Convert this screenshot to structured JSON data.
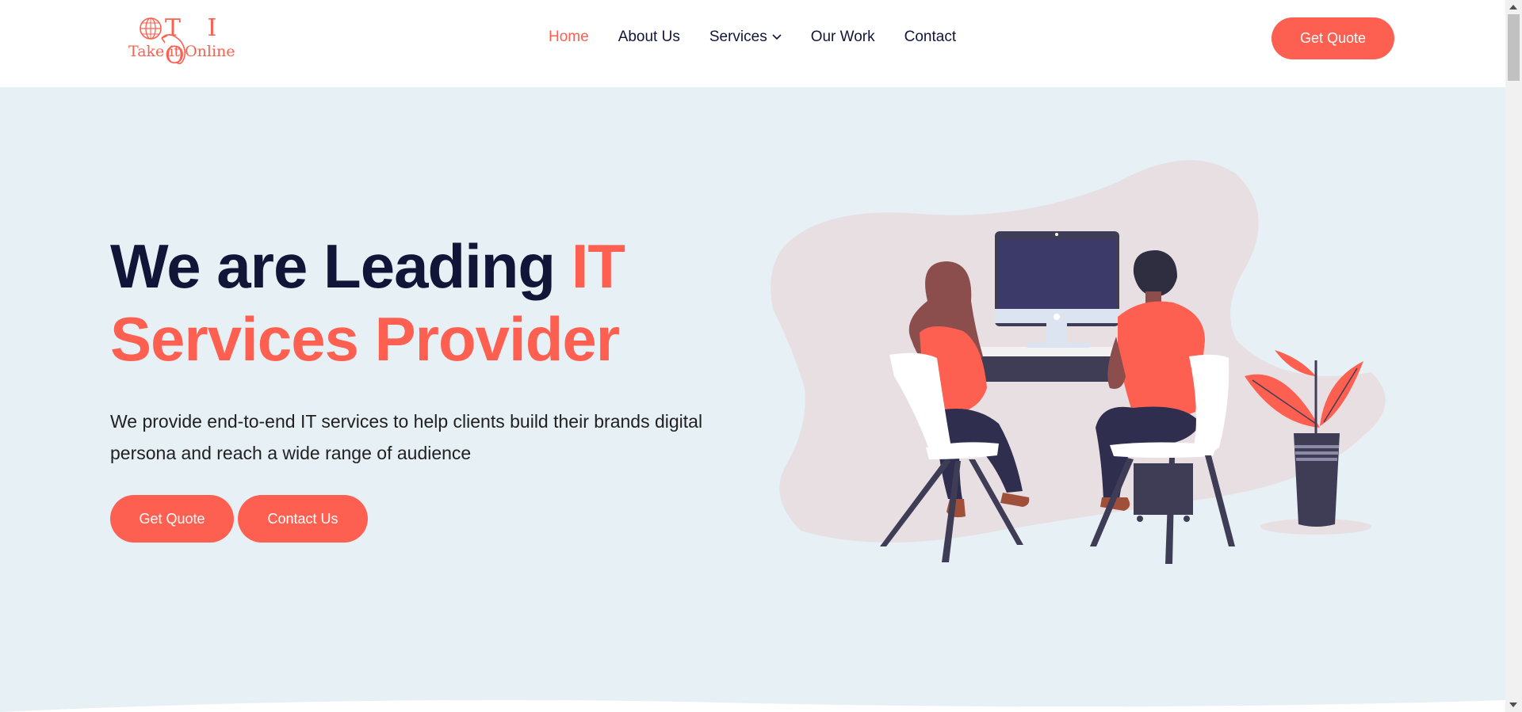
{
  "header": {
    "logo": {
      "letters": "T I O",
      "tagline": "Take it Online"
    },
    "nav": [
      {
        "label": "Home",
        "active": true
      },
      {
        "label": "About Us",
        "active": false
      },
      {
        "label": "Services",
        "active": false,
        "has_dropdown": true
      },
      {
        "label": "Our Work",
        "active": false
      },
      {
        "label": "Contact",
        "active": false
      }
    ],
    "cta_label": "Get Quote"
  },
  "hero": {
    "title_line1": "We are Leading ",
    "title_accent1": "IT",
    "title_line2": "Services Provider",
    "description": "We provide end-to-end IT services to help clients build their brands digital persona and reach a wide range of audience",
    "buttons": {
      "quote": "Get Quote",
      "contact": "Contact Us"
    },
    "illustration_icon": "two-people-at-desktop-illustration"
  },
  "colors": {
    "accent": "#fd5f50",
    "heading": "#111639",
    "hero_bg": "#e6f0f5",
    "blob": "#e8dfe3"
  }
}
